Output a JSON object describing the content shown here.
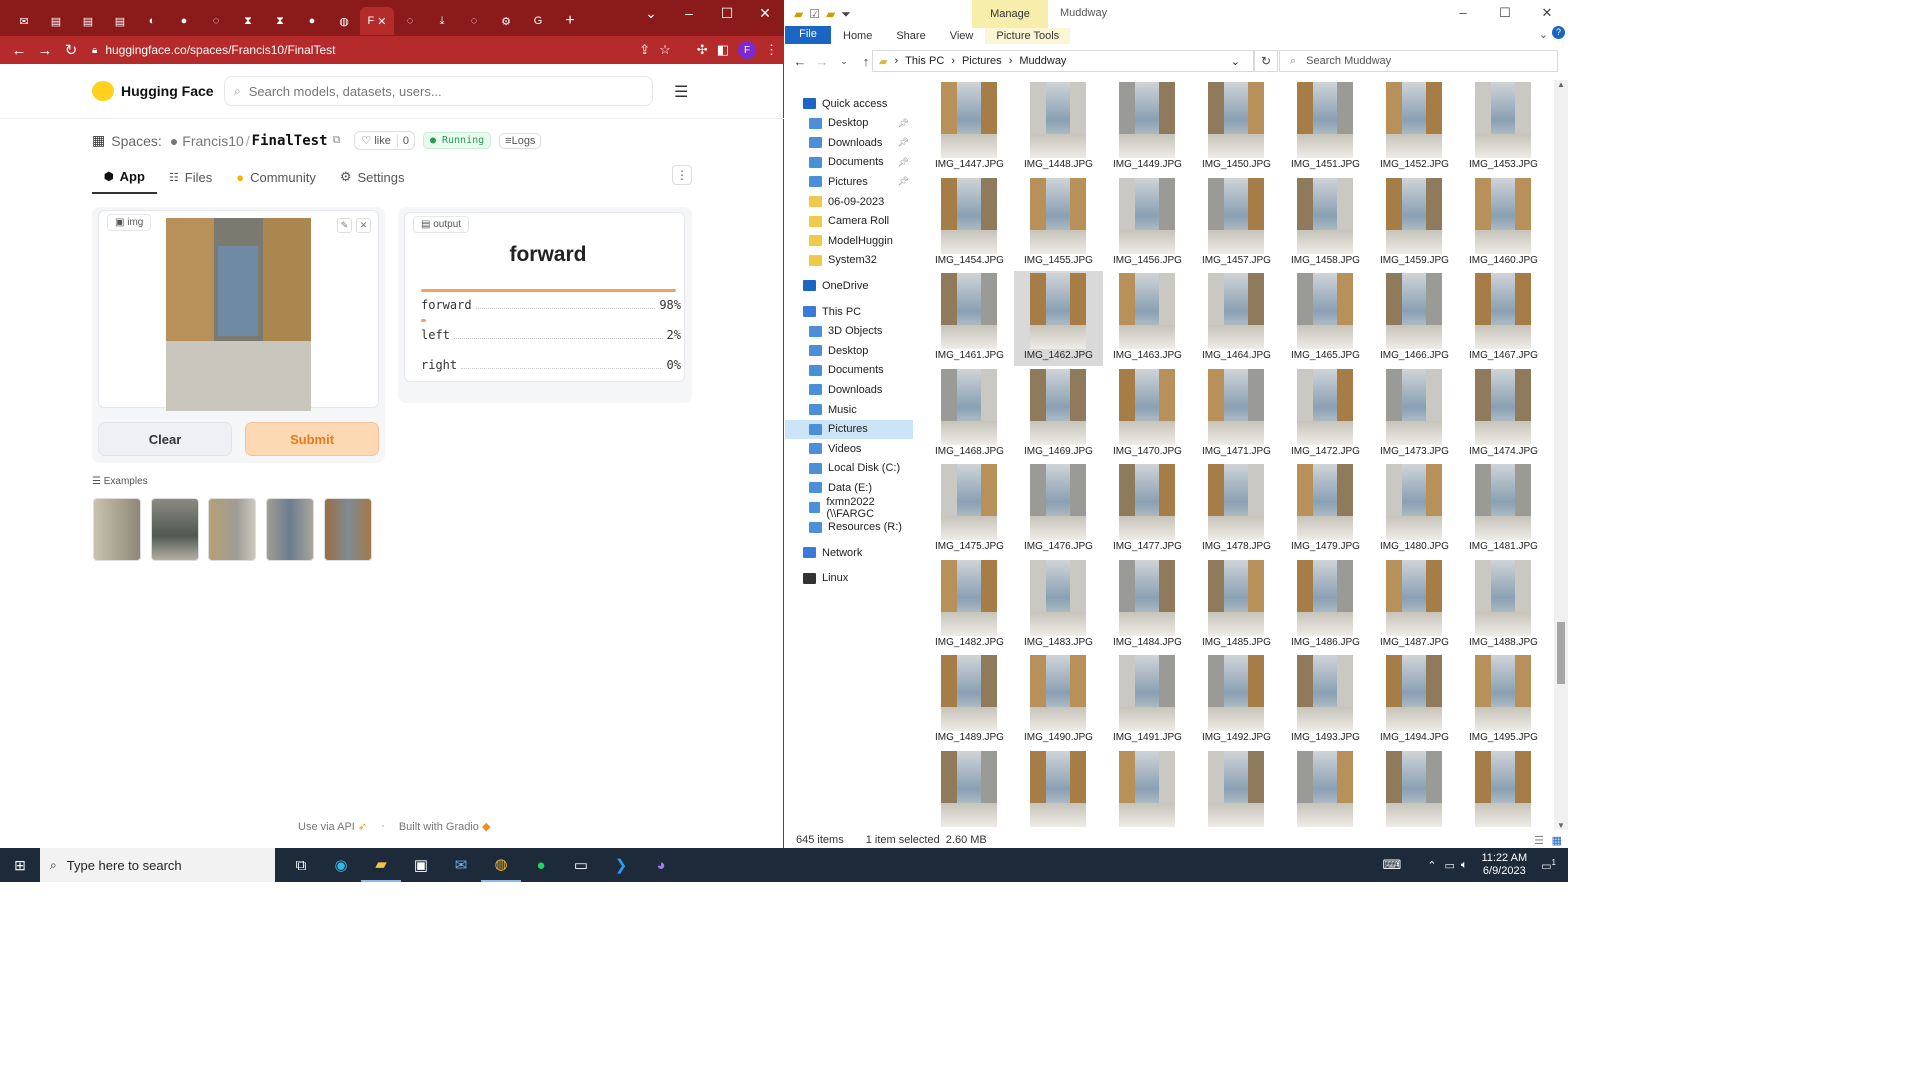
{
  "browser": {
    "active_tab_label": "F",
    "url": "huggingface.co/spaces/Francis10/FinalTest",
    "profile_initial": "F"
  },
  "hf": {
    "brand": "Hugging Face",
    "search_placeholder": "Search models, datasets, users...",
    "spaces_label": "Spaces:",
    "owner": "Francis10",
    "slash": "/",
    "space_name": "FinalTest",
    "like_label": "like",
    "like_count": "0",
    "status": "Running",
    "logs_label": "Logs",
    "tabs": [
      {
        "label": "App"
      },
      {
        "label": "Files"
      },
      {
        "label": "Community"
      },
      {
        "label": "Settings"
      }
    ],
    "input_label": "img",
    "output_label": "output",
    "prediction": "forward",
    "confidences": [
      {
        "label": "forward",
        "value": "98%",
        "fraction": 0.98
      },
      {
        "label": "left",
        "value": "2%",
        "fraction": 0.02
      },
      {
        "label": "right",
        "value": "0%",
        "fraction": 0.0
      }
    ],
    "clear_label": "Clear",
    "submit_label": "Submit",
    "examples_label": "Examples",
    "footer_api": "Use via API",
    "footer_built": "Built with Gradio"
  },
  "explorer": {
    "ribbon_context": "Manage",
    "window_title": "Muddway",
    "ribbon_tabs": {
      "file": "File",
      "home": "Home",
      "share": "Share",
      "view": "View",
      "picture_tools": "Picture Tools"
    },
    "breadcrumb": [
      "This PC",
      "Pictures",
      "Muddway"
    ],
    "search_placeholder": "Search Muddway",
    "nav": [
      {
        "label": "Quick access",
        "indent": false,
        "pinned": false
      },
      {
        "label": "Desktop",
        "indent": true,
        "pinned": true
      },
      {
        "label": "Downloads",
        "indent": true,
        "pinned": true
      },
      {
        "label": "Documents",
        "indent": true,
        "pinned": true
      },
      {
        "label": "Pictures",
        "indent": true,
        "pinned": true
      },
      {
        "label": "06-09-2023",
        "indent": true,
        "pinned": false
      },
      {
        "label": "Camera Roll",
        "indent": true,
        "pinned": false
      },
      {
        "label": "ModelHuggin",
        "indent": true,
        "pinned": false
      },
      {
        "label": "System32",
        "indent": true,
        "pinned": false
      },
      {
        "label": "OneDrive",
        "indent": false,
        "pinned": false
      },
      {
        "label": "This PC",
        "indent": false,
        "pinned": false
      },
      {
        "label": "3D Objects",
        "indent": true,
        "pinned": false
      },
      {
        "label": "Desktop",
        "indent": true,
        "pinned": false
      },
      {
        "label": "Documents",
        "indent": true,
        "pinned": false
      },
      {
        "label": "Downloads",
        "indent": true,
        "pinned": false
      },
      {
        "label": "Music",
        "indent": true,
        "pinned": false
      },
      {
        "label": "Pictures",
        "indent": true,
        "pinned": false
      },
      {
        "label": "Videos",
        "indent": true,
        "pinned": false
      },
      {
        "label": "Local Disk (C:)",
        "indent": true,
        "pinned": false
      },
      {
        "label": "Data (E:)",
        "indent": true,
        "pinned": false
      },
      {
        "label": "fxmn2022 (\\\\FARGC",
        "indent": true,
        "pinned": false
      },
      {
        "label": "Resources (R:)",
        "indent": true,
        "pinned": false
      },
      {
        "label": "Network",
        "indent": false,
        "pinned": false
      },
      {
        "label": "Linux",
        "indent": false,
        "pinned": false
      }
    ],
    "selected_nav": "Pictures",
    "files": [
      "IMG_1447.JPG",
      "IMG_1448.JPG",
      "IMG_1449.JPG",
      "IMG_1450.JPG",
      "IMG_1451.JPG",
      "IMG_1452.JPG",
      "IMG_1453.JPG",
      "IMG_1454.JPG",
      "IMG_1455.JPG",
      "IMG_1456.JPG",
      "IMG_1457.JPG",
      "IMG_1458.JPG",
      "IMG_1459.JPG",
      "IMG_1460.JPG",
      "IMG_1461.JPG",
      "IMG_1462.JPG",
      "IMG_1463.JPG",
      "IMG_1464.JPG",
      "IMG_1465.JPG",
      "IMG_1466.JPG",
      "IMG_1467.JPG",
      "IMG_1468.JPG",
      "IMG_1469.JPG",
      "IMG_1470.JPG",
      "IMG_1471.JPG",
      "IMG_1472.JPG",
      "IMG_1473.JPG",
      "IMG_1474.JPG",
      "IMG_1475.JPG",
      "IMG_1476.JPG",
      "IMG_1477.JPG",
      "IMG_1478.JPG",
      "IMG_1479.JPG",
      "IMG_1480.JPG",
      "IMG_1481.JPG",
      "IMG_1482.JPG",
      "IMG_1483.JPG",
      "IMG_1484.JPG",
      "IMG_1485.JPG",
      "IMG_1486.JPG",
      "IMG_1487.JPG",
      "IMG_1488.JPG",
      "IMG_1489.JPG",
      "IMG_1490.JPG",
      "IMG_1491.JPG",
      "IMG_1492.JPG",
      "IMG_1493.JPG",
      "IMG_1494.JPG",
      "IMG_1495.JPG",
      "",
      "",
      "",
      "",
      "",
      "",
      ""
    ],
    "selected_file": "IMG_1462.JPG",
    "item_count": "645 items",
    "selection_info": "1 item selected  2.60 MB"
  },
  "taskbar": {
    "search_placeholder": "Type here to search",
    "time": "11:22 AM",
    "date": "6/9/2023",
    "notification_count": "1"
  }
}
